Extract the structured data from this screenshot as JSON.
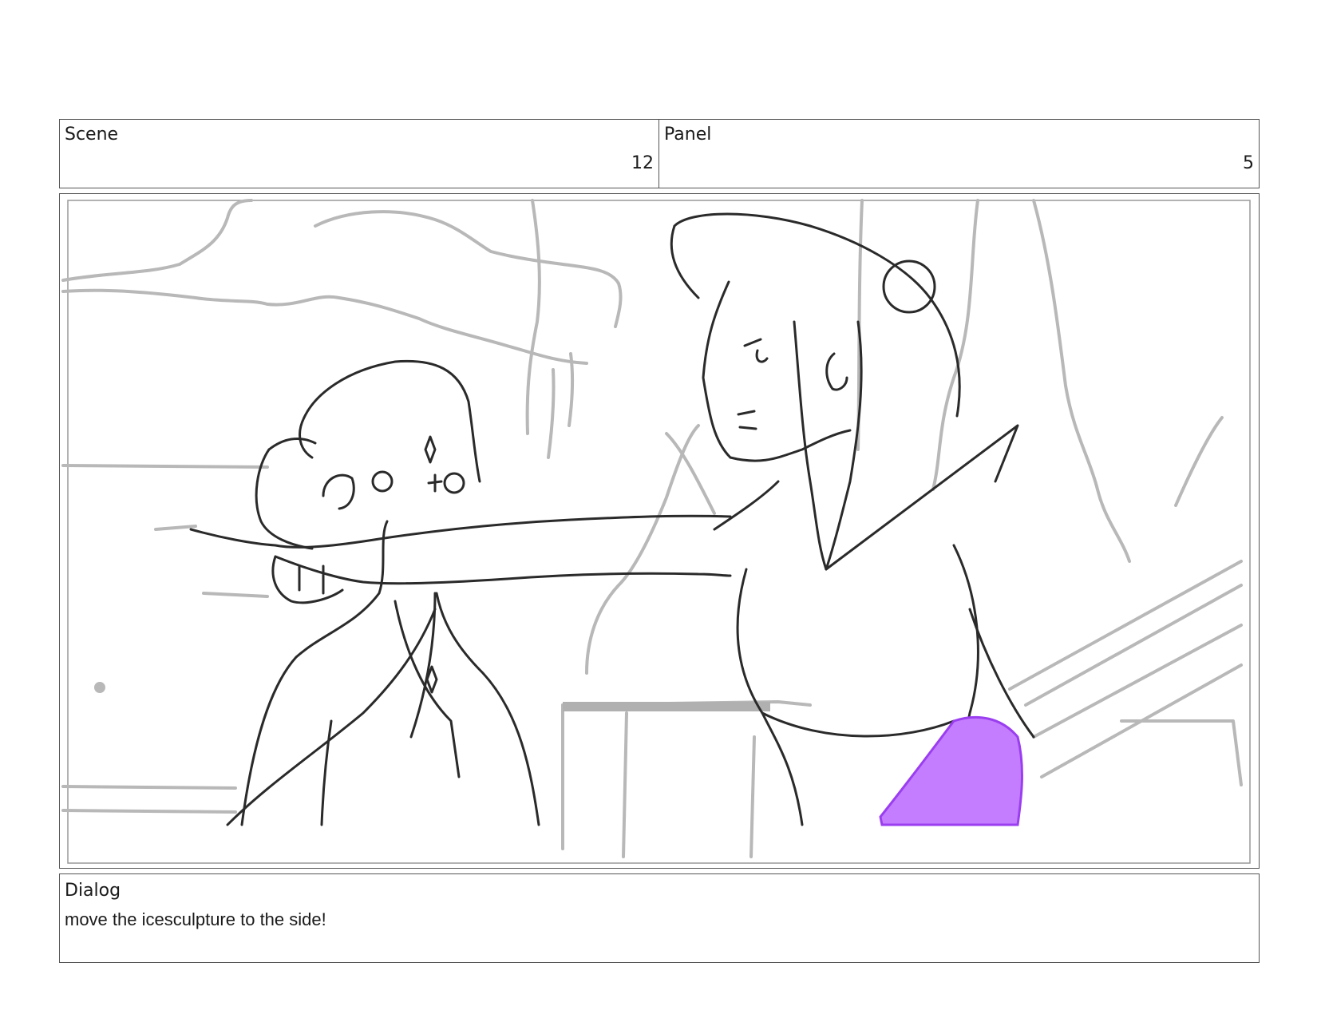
{
  "scene": {
    "label": "Scene",
    "value": "12"
  },
  "panel": {
    "label": "Panel",
    "value": "5"
  },
  "dialog": {
    "label": "Dialog",
    "text": "move the icesculpture to the side!"
  }
}
